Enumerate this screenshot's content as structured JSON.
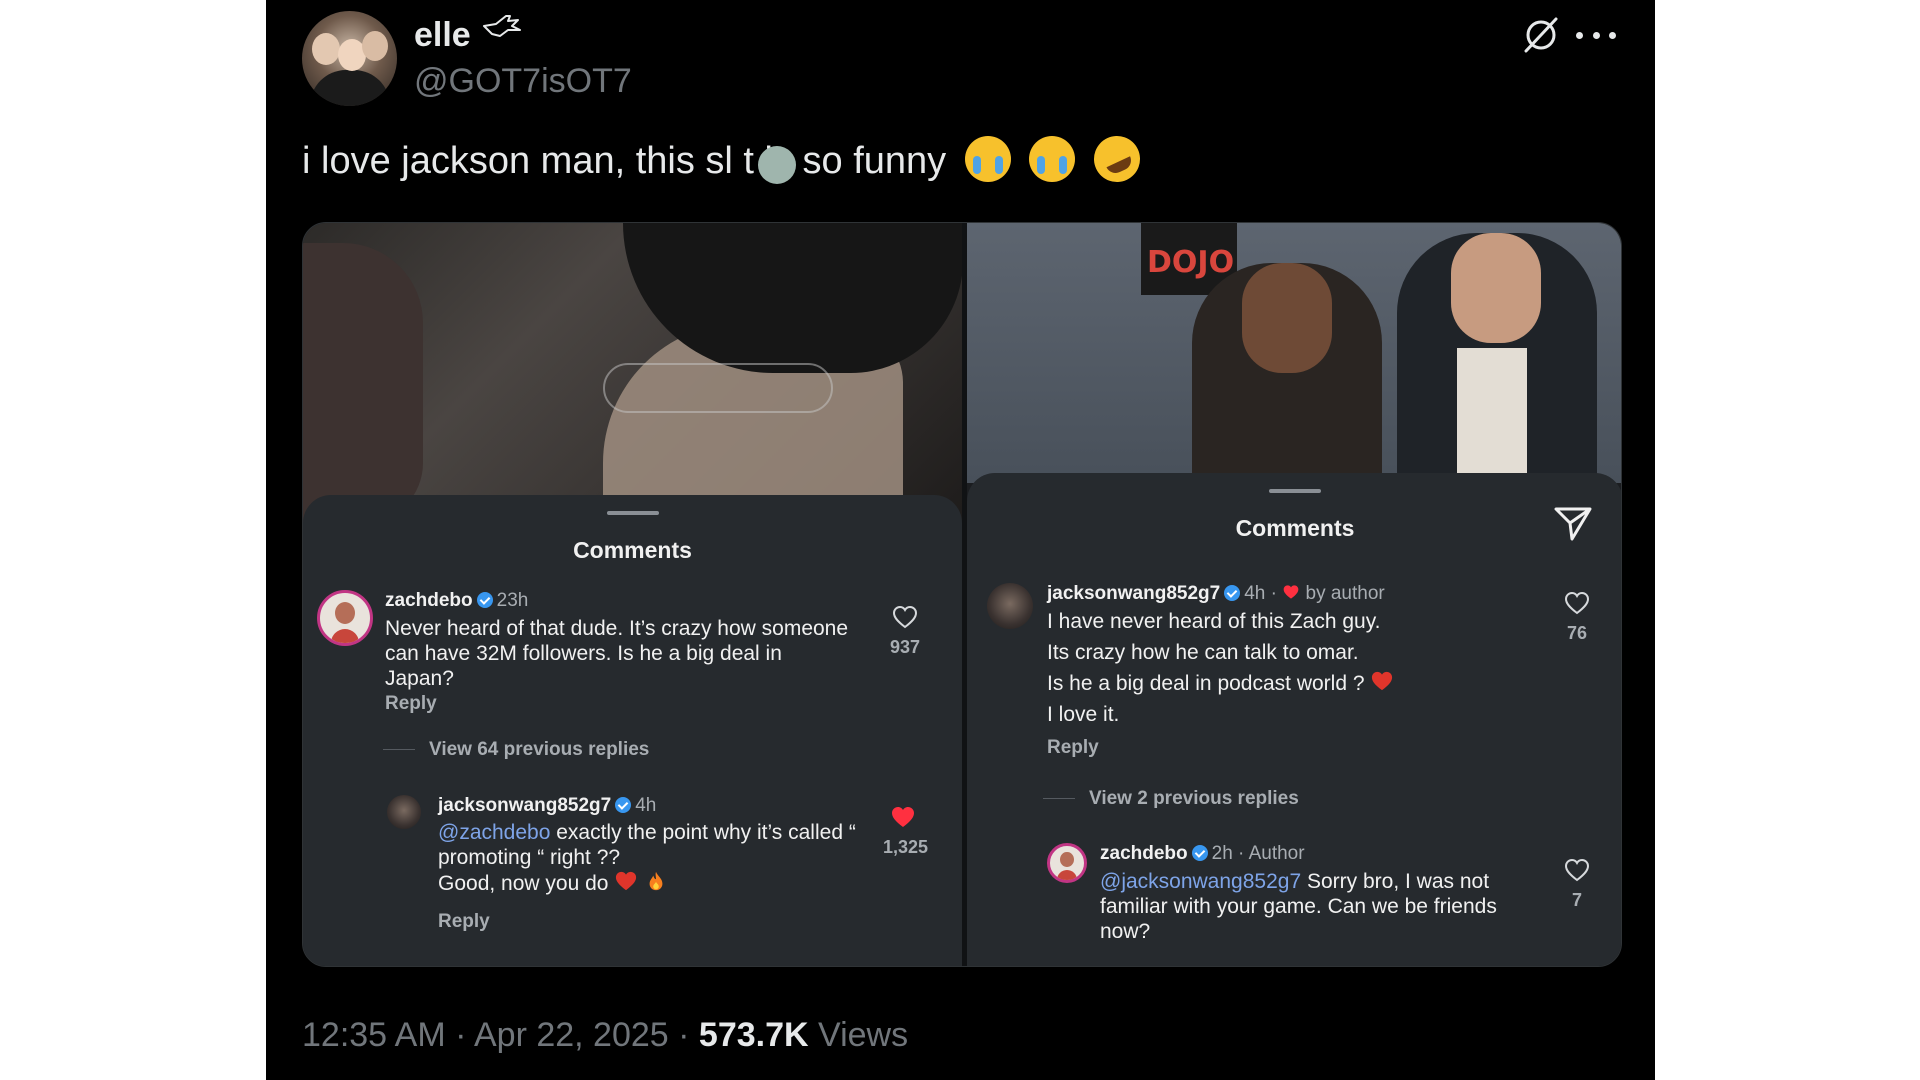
{
  "tweet": {
    "display_name": "elle",
    "handle": "@GOT7isOT7",
    "text": "i love jackson man, this sl  t is so funny",
    "timestamp": "12:35 AM · Apr 22, 2025 · ",
    "views_count": "573.7K",
    "views_label": " Views"
  },
  "left_panel": {
    "title": "Comments",
    "comment1": {
      "username": "zachdebo",
      "time": "23h",
      "text": "Never heard of that dude. It’s crazy how someone can have 32M followers. Is he a big deal in Japan?",
      "reply": "Reply",
      "likes": "937"
    },
    "view_replies": "View 64 previous replies",
    "comment2": {
      "username": "jacksonwang852g7",
      "time": "4h",
      "mention": "@zachdebo",
      "text": " exactly the point why it’s called “ promoting “ right ??",
      "text2": "Good, now you do",
      "reply": "Reply",
      "likes": "1,325"
    }
  },
  "right_panel": {
    "title": "Comments",
    "sign_text": "DOJO",
    "comment1": {
      "username": "jacksonwang852g7",
      "time": "4h ·",
      "liked_by": "by author",
      "line1": "I have never heard of this Zach guy.",
      "line2": "Its crazy how he can talk to omar.",
      "line3": "Is he a big deal in podcast world ?",
      "line4": "I love it.",
      "reply": "Reply",
      "likes": "76"
    },
    "view_replies": "View 2 previous replies",
    "comment2": {
      "username": "zachdebo",
      "time": "2h · Author",
      "mention": "@jacksonwang852g7",
      "text": " Sorry bro, I was not familiar with your game. Can we be friends now?",
      "likes": "7"
    }
  },
  "icons": {
    "bird": "bird-icon",
    "grok": "grok-icon",
    "more": "more-icon",
    "heart": "heart-icon",
    "send": "send-icon",
    "verified": "verified-badge-icon"
  },
  "colors": {
    "background": "#000000",
    "text_primary": "#e7e9ea",
    "text_secondary": "#71767b",
    "sheet": "#262a2e",
    "mention": "#7ea4e8",
    "heart_red": "#ff3040",
    "verified_blue": "#3897f0"
  }
}
